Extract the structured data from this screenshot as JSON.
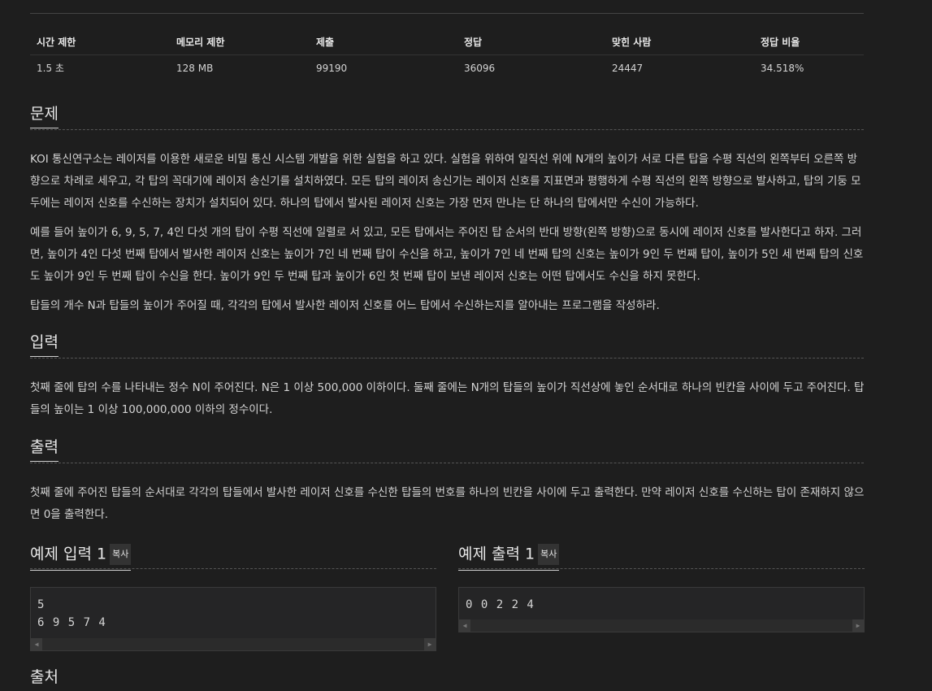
{
  "stats": {
    "headers": [
      "시간 제한",
      "메모리 제한",
      "제출",
      "정답",
      "맞힌 사람",
      "정답 비율"
    ],
    "values": [
      "1.5 초",
      "128 MB",
      "99190",
      "36096",
      "24447",
      "34.518%"
    ]
  },
  "problem": {
    "title": "문제",
    "p1": "KOI 통신연구소는 레이저를 이용한 새로운 비밀 통신 시스템 개발을 위한 실험을 하고 있다. 실험을 위하여 일직선 위에 N개의 높이가 서로 다른 탑을 수평 직선의 왼쪽부터 오른쪽 방향으로 차례로 세우고, 각 탑의 꼭대기에 레이저 송신기를 설치하였다. 모든 탑의 레이저 송신기는 레이저 신호를 지표면과 평행하게 수평 직선의 왼쪽 방향으로 발사하고, 탑의 기둥 모두에는 레이저 신호를 수신하는 장치가 설치되어 있다. 하나의 탑에서 발사된 레이저 신호는 가장 먼저 만나는 단 하나의 탑에서만 수신이 가능하다.",
    "p2": "예를 들어 높이가 6, 9, 5, 7, 4인 다섯 개의 탑이 수평 직선에 일렬로 서 있고, 모든 탑에서는 주어진 탑 순서의 반대 방향(왼쪽 방향)으로 동시에 레이저 신호를 발사한다고 하자. 그러면, 높이가 4인 다섯 번째 탑에서 발사한 레이저 신호는 높이가 7인 네 번째 탑이 수신을 하고, 높이가 7인 네 번째 탑의 신호는 높이가 9인 두 번째 탑이, 높이가 5인 세 번째 탑의 신호도 높이가 9인 두 번째 탑이 수신을 한다. 높이가 9인 두 번째 탑과 높이가 6인 첫 번째 탑이 보낸 레이저 신호는 어떤 탑에서도 수신을 하지 못한다.",
    "p3": "탑들의 개수 N과 탑들의 높이가 주어질 때, 각각의 탑에서 발사한 레이저 신호를 어느 탑에서 수신하는지를 알아내는 프로그램을 작성하라."
  },
  "input": {
    "title": "입력",
    "p1": "첫째 줄에 탑의 수를 나타내는 정수 N이 주어진다. N은 1 이상 500,000 이하이다. 둘째 줄에는 N개의 탑들의 높이가 직선상에 놓인 순서대로 하나의 빈칸을 사이에 두고 주어진다. 탑들의 높이는 1 이상 100,000,000 이하의 정수이다."
  },
  "output": {
    "title": "출력",
    "p1": "첫째 줄에 주어진 탑들의 순서대로 각각의 탑들에서 발사한 레이저 신호를 수신한 탑들의 번호를 하나의 빈칸을 사이에 두고 출력한다. 만약 레이저 신호를 수신하는 탑이 존재하지 않으면 0을 출력한다."
  },
  "sample_input": {
    "title": "예제 입력 1",
    "copy_label": "복사",
    "code": "5\n6 9 5 7 4"
  },
  "sample_output": {
    "title": "예제 출력 1",
    "copy_label": "복사",
    "code": "0 0 2 2 4"
  },
  "source": {
    "title": "출처"
  }
}
